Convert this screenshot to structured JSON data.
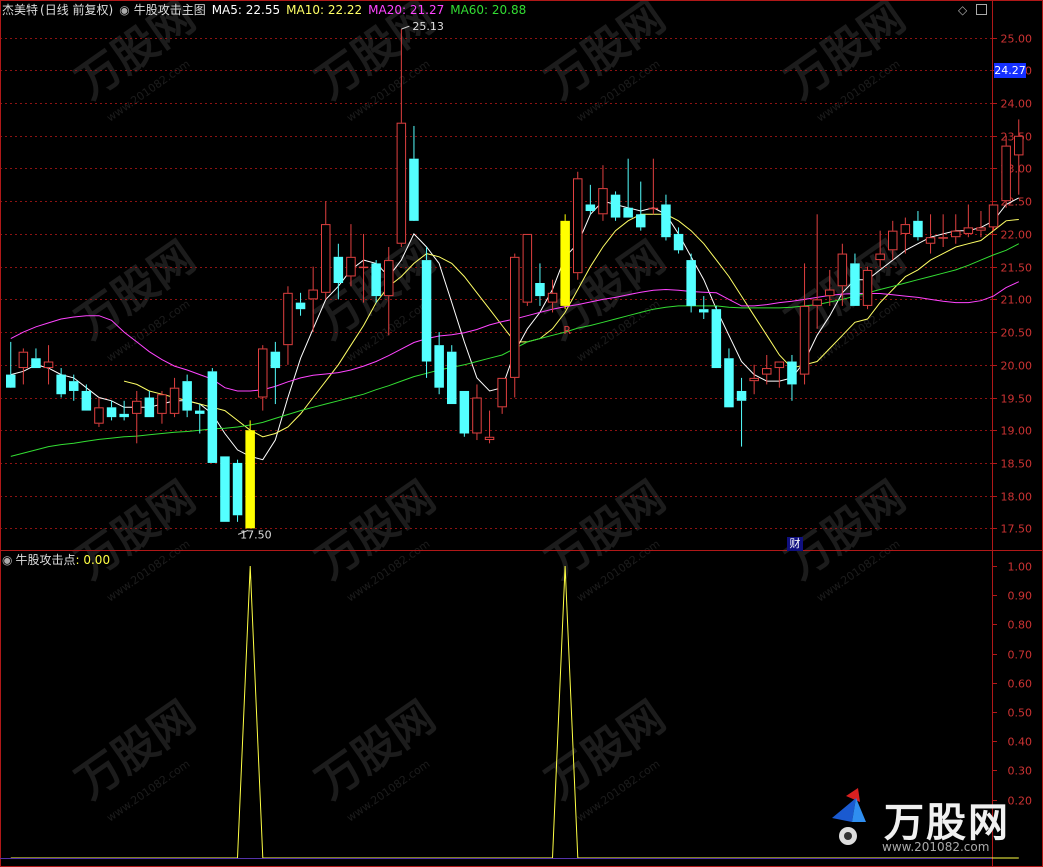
{
  "colors": {
    "background": "#000000",
    "frame": "#b01818",
    "up": "#e04040",
    "down": "#54ffff",
    "signal": "#ffff00",
    "ma5": "#ffffff",
    "ma10": "#ffff66",
    "ma20": "#ff44ff",
    "ma60": "#33dd33",
    "axis_text": "#cc3333",
    "price_tag_bg": "#1530ff",
    "watermark": "#333333",
    "indicator_line": "#ffff44"
  },
  "header": {
    "stock": "杰美特",
    "period": "(日线 前复权)",
    "indicator_name": "牛股攻击主图",
    "ma5": "MA5: 22.55",
    "ma10": "MA10: 22.22",
    "ma20": "MA20: 21.27",
    "ma60": "MA60: 20.88"
  },
  "lower_header": {
    "name": "牛股攻击点",
    "value": ": 0.00"
  },
  "price_tag": "24.27",
  "markers": {
    "high": "25.13",
    "low": "17.50",
    "r_label": "R",
    "cai_label": "财"
  },
  "watermark": {
    "brand": "万股网",
    "site": "www.201082.com"
  },
  "chart_data": [
    {
      "type": "candlestick",
      "title": "牛股攻击主图",
      "ylim": [
        17.2,
        25.3
      ],
      "y_ticks": [
        "25.00",
        "24.50",
        "24.00",
        "23.50",
        "23.00",
        "22.50",
        "22.00",
        "21.50",
        "21.00",
        "20.50",
        "20.00",
        "19.50",
        "19.00",
        "18.50",
        "18.00",
        "17.50"
      ],
      "candles": [
        {
          "o": 19.85,
          "h": 20.35,
          "l": 19.7,
          "c": 19.65
        },
        {
          "o": 19.95,
          "h": 20.25,
          "l": 19.7,
          "c": 20.2
        },
        {
          "o": 20.1,
          "h": 20.25,
          "l": 19.95,
          "c": 19.95
        },
        {
          "o": 19.95,
          "h": 20.3,
          "l": 19.7,
          "c": 20.05
        },
        {
          "o": 19.85,
          "h": 19.95,
          "l": 19.5,
          "c": 19.55
        },
        {
          "o": 19.75,
          "h": 19.85,
          "l": 19.45,
          "c": 19.6
        },
        {
          "o": 19.6,
          "h": 19.7,
          "l": 19.3,
          "c": 19.3
        },
        {
          "o": 19.1,
          "h": 19.5,
          "l": 19.05,
          "c": 19.35
        },
        {
          "o": 19.35,
          "h": 19.45,
          "l": 19.15,
          "c": 19.2
        },
        {
          "o": 19.25,
          "h": 19.45,
          "l": 19.15,
          "c": 19.2
        },
        {
          "o": 19.25,
          "h": 19.6,
          "l": 18.8,
          "c": 19.45
        },
        {
          "o": 19.5,
          "h": 19.6,
          "l": 19.2,
          "c": 19.2
        },
        {
          "o": 19.25,
          "h": 19.6,
          "l": 19.1,
          "c": 19.55
        },
        {
          "o": 19.25,
          "h": 19.8,
          "l": 19.2,
          "c": 19.65
        },
        {
          "o": 19.75,
          "h": 19.85,
          "l": 19.2,
          "c": 19.3
        },
        {
          "o": 19.3,
          "h": 19.4,
          "l": 18.95,
          "c": 19.25
        },
        {
          "o": 19.9,
          "h": 19.95,
          "l": 18.5,
          "c": 18.5
        },
        {
          "o": 18.6,
          "h": 18.6,
          "l": 17.6,
          "c": 17.6
        },
        {
          "o": 18.5,
          "h": 18.55,
          "l": 17.6,
          "c": 17.7
        },
        {
          "o": 17.5,
          "h": 19.15,
          "l": 17.5,
          "c": 19.0,
          "signal": true
        },
        {
          "o": 19.5,
          "h": 20.3,
          "l": 19.3,
          "c": 20.25
        },
        {
          "o": 20.2,
          "h": 20.35,
          "l": 19.4,
          "c": 19.95
        },
        {
          "o": 20.3,
          "h": 21.2,
          "l": 20.0,
          "c": 21.1
        },
        {
          "o": 20.95,
          "h": 21.1,
          "l": 20.75,
          "c": 20.85
        },
        {
          "o": 21.0,
          "h": 21.5,
          "l": 20.5,
          "c": 21.15
        },
        {
          "o": 21.1,
          "h": 22.5,
          "l": 21.0,
          "c": 22.15
        },
        {
          "o": 21.65,
          "h": 21.85,
          "l": 21.0,
          "c": 21.25
        },
        {
          "o": 21.35,
          "h": 22.15,
          "l": 21.2,
          "c": 21.65
        },
        {
          "o": 21.5,
          "h": 22.0,
          "l": 20.95,
          "c": 21.5
        },
        {
          "o": 21.55,
          "h": 21.6,
          "l": 20.95,
          "c": 21.05
        },
        {
          "o": 21.05,
          "h": 21.8,
          "l": 20.45,
          "c": 21.6
        },
        {
          "o": 21.85,
          "h": 25.13,
          "l": 21.8,
          "c": 23.7
        },
        {
          "o": 23.15,
          "h": 23.65,
          "l": 22.3,
          "c": 22.2
        },
        {
          "o": 21.6,
          "h": 21.8,
          "l": 19.8,
          "c": 20.05
        },
        {
          "o": 20.3,
          "h": 20.5,
          "l": 19.55,
          "c": 19.65
        },
        {
          "o": 20.2,
          "h": 20.3,
          "l": 19.4,
          "c": 19.4
        },
        {
          "o": 19.6,
          "h": 19.6,
          "l": 18.9,
          "c": 18.95
        },
        {
          "o": 18.95,
          "h": 19.7,
          "l": 18.85,
          "c": 19.5
        },
        {
          "o": 18.85,
          "h": 19.3,
          "l": 18.8,
          "c": 18.9
        },
        {
          "o": 19.35,
          "h": 19.8,
          "l": 19.25,
          "c": 19.8
        },
        {
          "o": 19.8,
          "h": 21.7,
          "l": 19.5,
          "c": 21.65
        },
        {
          "o": 20.95,
          "h": 22.0,
          "l": 20.9,
          "c": 22.0
        },
        {
          "o": 21.25,
          "h": 21.55,
          "l": 20.9,
          "c": 21.05
        },
        {
          "o": 20.95,
          "h": 21.3,
          "l": 20.8,
          "c": 21.1
        },
        {
          "o": 20.9,
          "h": 22.3,
          "l": 20.85,
          "c": 22.2,
          "signal": true
        },
        {
          "o": 21.4,
          "h": 22.95,
          "l": 21.3,
          "c": 22.85
        },
        {
          "o": 22.45,
          "h": 22.75,
          "l": 22.3,
          "c": 22.35
        },
        {
          "o": 22.3,
          "h": 23.05,
          "l": 22.2,
          "c": 22.7
        },
        {
          "o": 22.6,
          "h": 22.65,
          "l": 22.2,
          "c": 22.25
        },
        {
          "o": 22.4,
          "h": 23.15,
          "l": 22.25,
          "c": 22.25
        },
        {
          "o": 22.3,
          "h": 22.8,
          "l": 22.05,
          "c": 22.1
        },
        {
          "o": 22.4,
          "h": 23.15,
          "l": 22.3,
          "c": 22.4
        },
        {
          "o": 22.45,
          "h": 22.6,
          "l": 21.9,
          "c": 21.95
        },
        {
          "o": 22.0,
          "h": 22.1,
          "l": 21.7,
          "c": 21.75
        },
        {
          "o": 21.6,
          "h": 21.7,
          "l": 20.8,
          "c": 20.9
        },
        {
          "o": 20.85,
          "h": 21.05,
          "l": 20.7,
          "c": 20.8
        },
        {
          "o": 20.85,
          "h": 20.9,
          "l": 19.95,
          "c": 19.95
        },
        {
          "o": 20.1,
          "h": 20.25,
          "l": 19.35,
          "c": 19.35
        },
        {
          "o": 19.6,
          "h": 19.8,
          "l": 18.75,
          "c": 19.45
        },
        {
          "o": 19.75,
          "h": 20.0,
          "l": 19.55,
          "c": 19.8
        },
        {
          "o": 19.85,
          "h": 20.15,
          "l": 19.7,
          "c": 19.95
        },
        {
          "o": 19.95,
          "h": 20.05,
          "l": 19.65,
          "c": 20.05
        },
        {
          "o": 20.05,
          "h": 20.15,
          "l": 19.45,
          "c": 19.7
        },
        {
          "o": 19.85,
          "h": 21.55,
          "l": 19.7,
          "c": 20.9
        },
        {
          "o": 20.9,
          "h": 22.3,
          "l": 20.55,
          "c": 21.0
        },
        {
          "o": 21.05,
          "h": 21.45,
          "l": 20.9,
          "c": 21.15
        },
        {
          "o": 21.2,
          "h": 21.85,
          "l": 20.9,
          "c": 21.7
        },
        {
          "o": 21.55,
          "h": 21.7,
          "l": 20.9,
          "c": 20.9
        },
        {
          "o": 20.9,
          "h": 21.5,
          "l": 20.85,
          "c": 21.45
        },
        {
          "o": 21.6,
          "h": 22.05,
          "l": 21.5,
          "c": 21.7
        },
        {
          "o": 21.75,
          "h": 22.2,
          "l": 21.6,
          "c": 22.05
        },
        {
          "o": 22.0,
          "h": 22.25,
          "l": 21.7,
          "c": 22.15
        },
        {
          "o": 22.2,
          "h": 22.35,
          "l": 21.9,
          "c": 21.95
        },
        {
          "o": 21.85,
          "h": 22.3,
          "l": 21.7,
          "c": 21.95
        },
        {
          "o": 21.95,
          "h": 22.3,
          "l": 21.8,
          "c": 21.95
        },
        {
          "o": 21.95,
          "h": 22.3,
          "l": 21.85,
          "c": 22.05
        },
        {
          "o": 22.0,
          "h": 22.45,
          "l": 21.95,
          "c": 22.1
        },
        {
          "o": 22.05,
          "h": 22.35,
          "l": 21.95,
          "c": 22.1
        },
        {
          "o": 22.1,
          "h": 22.45,
          "l": 22.05,
          "c": 22.45
        },
        {
          "o": 22.5,
          "h": 23.5,
          "l": 22.4,
          "c": 23.35
        },
        {
          "o": 23.2,
          "h": 23.75,
          "l": 22.6,
          "c": 23.5
        }
      ],
      "series": [
        {
          "name": "MA5",
          "values": [
            19.85,
            19.9,
            20.0,
            19.95,
            19.85,
            19.8,
            19.65,
            19.5,
            19.45,
            19.35,
            19.35,
            19.35,
            19.4,
            19.45,
            19.45,
            19.4,
            19.25,
            18.95,
            18.7,
            18.6,
            18.55,
            18.85,
            19.5,
            20.1,
            20.55,
            21.0,
            21.2,
            21.45,
            21.6,
            21.55,
            21.35,
            21.6,
            22.0,
            21.8,
            21.55,
            20.95,
            20.35,
            19.8,
            19.6,
            19.65,
            20.2,
            20.55,
            20.8,
            21.15,
            21.65,
            21.85,
            22.3,
            22.5,
            22.45,
            22.4,
            22.35,
            22.4,
            22.3,
            22.0,
            21.65,
            21.3,
            20.85,
            20.45,
            20.05,
            19.85,
            19.75,
            19.75,
            19.8,
            20.05,
            20.45,
            20.75,
            21.1,
            21.3,
            21.3,
            21.45,
            21.6,
            21.75,
            21.85,
            21.95,
            22.0,
            22.05,
            22.05,
            22.1,
            22.2,
            22.45,
            22.55
          ]
        },
        {
          "name": "MA10",
          "values": [
            null,
            null,
            null,
            null,
            null,
            null,
            null,
            null,
            null,
            19.75,
            19.7,
            19.6,
            19.55,
            19.5,
            19.45,
            19.4,
            19.35,
            19.3,
            19.15,
            19.0,
            18.9,
            18.95,
            19.05,
            19.25,
            19.5,
            19.75,
            20.0,
            20.3,
            20.6,
            20.95,
            21.2,
            21.35,
            21.55,
            21.7,
            21.65,
            21.55,
            21.35,
            21.1,
            20.85,
            20.6,
            20.35,
            20.35,
            20.4,
            20.55,
            20.8,
            21.15,
            21.5,
            21.8,
            22.05,
            22.2,
            22.3,
            22.3,
            22.3,
            22.2,
            22.05,
            21.85,
            21.6,
            21.35,
            21.05,
            20.75,
            20.45,
            20.15,
            19.95,
            20.0,
            20.05,
            20.25,
            20.45,
            20.65,
            20.7,
            20.95,
            21.15,
            21.35,
            21.45,
            21.6,
            21.7,
            21.8,
            21.85,
            21.9,
            22.05,
            22.2,
            22.22
          ]
        },
        {
          "name": "MA20",
          "values": [
            20.4,
            20.5,
            20.58,
            20.64,
            20.7,
            20.73,
            20.75,
            20.75,
            20.68,
            20.5,
            20.35,
            20.2,
            20.08,
            19.98,
            19.92,
            19.85,
            19.78,
            19.65,
            19.6,
            19.6,
            19.62,
            19.67,
            19.74,
            19.8,
            19.84,
            19.86,
            19.88,
            19.92,
            19.98,
            20.05,
            20.14,
            20.24,
            20.34,
            20.4,
            20.44,
            20.46,
            20.49,
            20.54,
            20.61,
            20.66,
            20.7,
            20.75,
            20.8,
            20.85,
            20.89,
            20.92,
            20.96,
            21.0,
            21.03,
            21.07,
            21.11,
            21.14,
            21.15,
            21.14,
            21.12,
            21.11,
            21.1,
            21.0,
            20.9,
            20.9,
            20.92,
            20.95,
            20.97,
            21.0,
            21.03,
            21.06,
            21.08,
            21.09,
            21.09,
            21.09,
            21.07,
            21.05,
            21.03,
            21.0,
            20.97,
            20.95,
            20.95,
            20.98,
            21.05,
            21.18,
            21.27
          ]
        },
        {
          "name": "MA60",
          "values": [
            18.6,
            18.65,
            18.7,
            18.75,
            18.78,
            18.8,
            18.83,
            18.86,
            18.88,
            18.9,
            18.91,
            18.93,
            18.95,
            18.97,
            18.98,
            19.0,
            19.02,
            19.03,
            19.05,
            19.08,
            19.12,
            19.18,
            19.24,
            19.3,
            19.35,
            19.4,
            19.45,
            19.5,
            19.55,
            19.62,
            19.68,
            19.75,
            19.82,
            19.87,
            19.92,
            19.96,
            20.0,
            20.05,
            20.1,
            20.15,
            20.25,
            20.35,
            20.4,
            20.45,
            20.5,
            20.56,
            20.6,
            20.65,
            20.7,
            20.75,
            20.8,
            20.85,
            20.88,
            20.9,
            20.9,
            20.9,
            20.9,
            20.88,
            20.87,
            20.87,
            20.87,
            20.87,
            20.88,
            20.9,
            20.92,
            20.96,
            21.0,
            21.05,
            21.1,
            21.15,
            21.2,
            21.25,
            21.3,
            21.35,
            21.4,
            21.45,
            21.52,
            21.6,
            21.68,
            21.75,
            21.85
          ]
        }
      ]
    },
    {
      "type": "line",
      "title": "牛股攻击点",
      "ylim": [
        0,
        1.0
      ],
      "y_ticks": [
        "1.00",
        "0.90",
        "0.80",
        "0.70",
        "0.60",
        "0.50",
        "0.40",
        "0.30",
        "0.20"
      ],
      "values": [
        0,
        0,
        0,
        0,
        0,
        0,
        0,
        0,
        0,
        0,
        0,
        0,
        0,
        0,
        0,
        0,
        0,
        0,
        0,
        1,
        0,
        0,
        0,
        0,
        0,
        0,
        0,
        0,
        0,
        0,
        0,
        0,
        0,
        0,
        0,
        0,
        0,
        0,
        0,
        0,
        0,
        0,
        0,
        0,
        1,
        0,
        0,
        0,
        0,
        0,
        0,
        0,
        0,
        0,
        0,
        0,
        0,
        0,
        0,
        0,
        0,
        0,
        0,
        0,
        0,
        0,
        0,
        0,
        0,
        0,
        0,
        0,
        0,
        0,
        0,
        0,
        0,
        0,
        0,
        0,
        0
      ]
    }
  ]
}
